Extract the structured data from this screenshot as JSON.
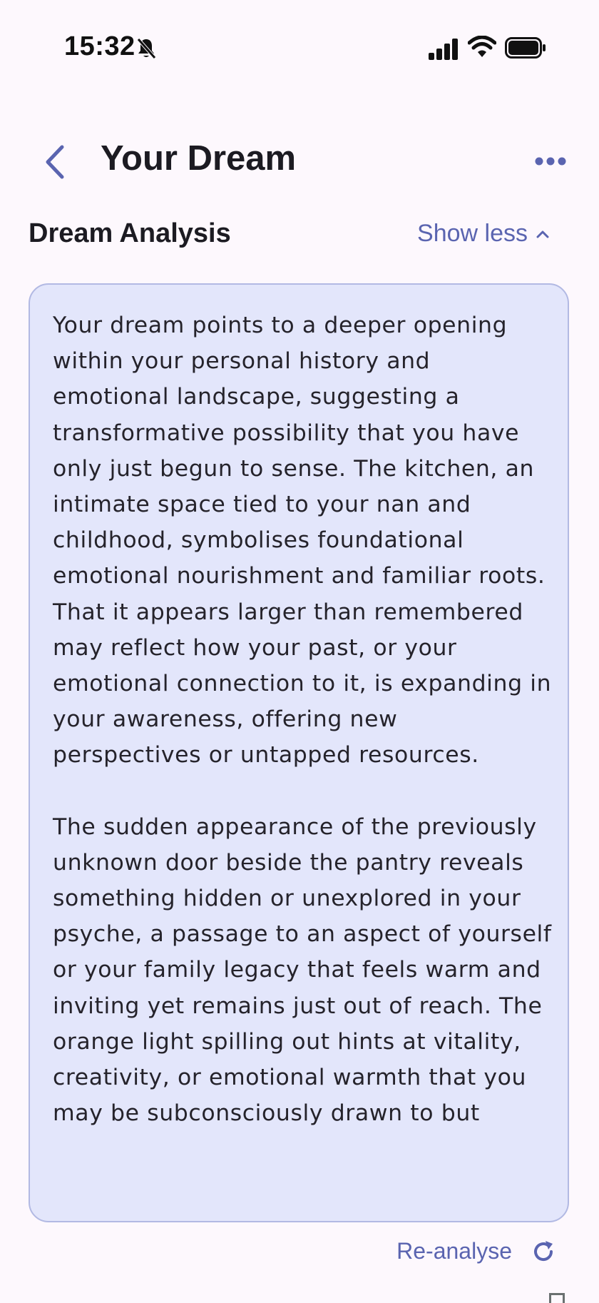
{
  "status_bar": {
    "time": "15:32",
    "icons": [
      "bell-slash-icon",
      "cellular-signal-icon",
      "wifi-icon",
      "battery-icon"
    ]
  },
  "header": {
    "title": "Your Dream",
    "back_icon": "chevron-left-icon",
    "more_icon": "more-horizontal-icon"
  },
  "analysis": {
    "section_title": "Dream Analysis",
    "toggle_label": "Show less",
    "toggle_icon": "chevron-up-icon",
    "paragraphs": [
      "Your dream points to a deeper opening within your personal history and emotional landscape, suggesting a transformative possibility that you have only just begun to sense. The kitchen, an intimate space tied to your nan and childhood, symbolises foundational emotional nourishment and familiar roots. That it appears larger than remembered may reflect how your past, or your emotional connection to it, is expanding in your awareness, offering new perspectives or untapped resources.",
      "The sudden appearance of the previously unknown door beside the pantry reveals something hidden or unexplored in your psyche, a passage to an aspect of yourself or your family legacy that feels warm and inviting yet remains just out of reach. The orange light spilling out hints at vitality, creativity, or emotional warmth that you may be subconsciously drawn to but"
    ]
  },
  "actions": {
    "reanalyse_label": "Re-analyse",
    "reanalyse_icon": "refresh-icon"
  },
  "colors": {
    "background": "#fdf8fd",
    "accent": "#5a64b0",
    "card_background": "#e3e6fb",
    "card_border": "#b2b9e3"
  }
}
